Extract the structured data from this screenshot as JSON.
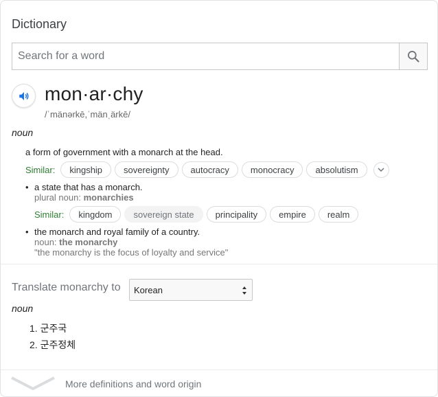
{
  "dictionary": {
    "title": "Dictionary",
    "search": {
      "placeholder": "Search for a word",
      "icon": "search-icon"
    },
    "entry": {
      "word": "mon·ar·chy",
      "phonetic": "/ˈmänərkē,ˈmänˌärkē/",
      "part_of_speech": "noun",
      "senses": [
        {
          "definition": "a form of government with a monarch at the head.",
          "similar_label": "Similar:",
          "similar": [
            "kingship",
            "sovereignty",
            "autocracy",
            "monocracy",
            "absolutism"
          ]
        },
        {
          "definition": "a state that has a monarch.",
          "plural_label": "plural noun:",
          "plural": "monarchies",
          "similar_label": "Similar:",
          "similar": [
            "kingdom",
            "sovereign state",
            "principality",
            "empire",
            "realm"
          ]
        },
        {
          "definition": "the monarch and royal family of a country.",
          "noun_label": "noun:",
          "noun_form": "the monarchy",
          "example": "\"the monarchy is the focus of loyalty and service\""
        }
      ]
    },
    "translate": {
      "label": "Translate monarchy to",
      "selected_language": "Korean",
      "part_of_speech": "noun",
      "items": [
        "1. 군주국",
        "2. 군주정체"
      ]
    },
    "footer": {
      "more_label": "More definitions and word origin"
    }
  },
  "colors": {
    "accent_blue": "#1a73e8",
    "similar_green": "#2e7d32",
    "muted": "#70757a"
  }
}
